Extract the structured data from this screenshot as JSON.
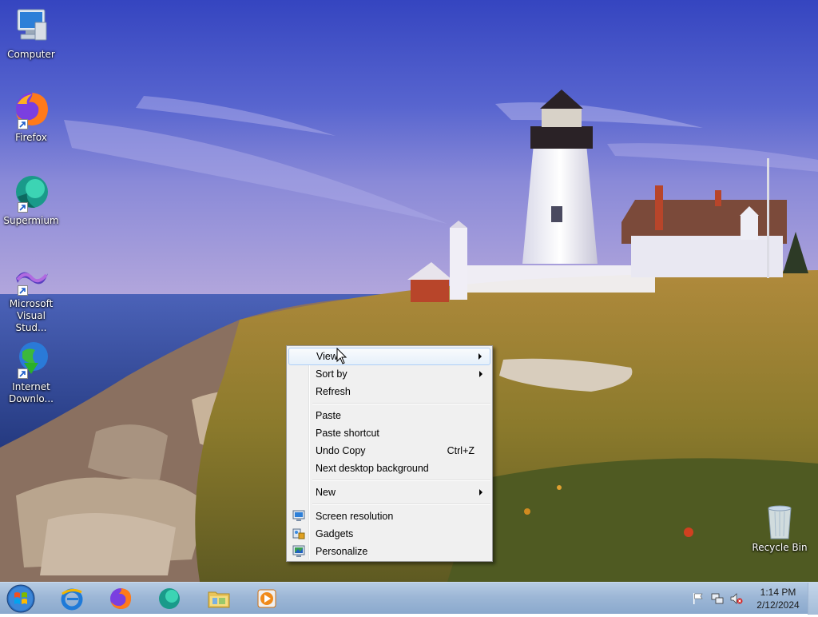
{
  "desktop": {
    "icons": [
      {
        "label": "Computer",
        "icon": "computer-icon"
      },
      {
        "label": "Firefox",
        "icon": "firefox-icon"
      },
      {
        "label": "Supermium",
        "icon": "supermium-icon"
      },
      {
        "label_line1": "Microsoft",
        "label_line2": "Visual Stud...",
        "icon": "visual-studio-icon"
      },
      {
        "label_line1": "Internet",
        "label_line2": "Downlo...",
        "icon": "internet-download-manager-icon"
      }
    ],
    "recycle_bin": {
      "label": "Recycle Bin",
      "icon": "recycle-bin-icon"
    }
  },
  "context_menu": {
    "items": [
      {
        "label": "View",
        "submenu": true,
        "highlighted": true
      },
      {
        "label": "Sort by",
        "submenu": true
      },
      {
        "label": "Refresh"
      },
      {
        "label": "Paste"
      },
      {
        "label": "Paste shortcut"
      },
      {
        "label": "Undo Copy",
        "shortcut": "Ctrl+Z"
      },
      {
        "label": "Next desktop background"
      },
      {
        "label": "New",
        "submenu": true
      },
      {
        "label": "Screen resolution",
        "icon": "screen-resolution-icon"
      },
      {
        "label": "Gadgets",
        "icon": "gadgets-icon"
      },
      {
        "label": "Personalize",
        "icon": "personalize-icon"
      }
    ]
  },
  "taskbar": {
    "buttons": [
      {
        "icon": "start-orb-icon"
      },
      {
        "icon": "internet-explorer-icon"
      },
      {
        "icon": "firefox-icon"
      },
      {
        "icon": "supermium-icon"
      },
      {
        "icon": "file-explorer-icon"
      },
      {
        "icon": "media-player-icon"
      }
    ],
    "tray": {
      "icons": [
        "action-center-flag-icon",
        "network-icon",
        "volume-muted-icon"
      ],
      "time": "1:14 PM",
      "date": "2/12/2024"
    }
  },
  "colors": {
    "sky_top": "#3b4fc4",
    "sea": "#2e4c9a",
    "taskbar": "#9db7d6",
    "menu_bg": "#f0f0f0",
    "menu_highlight_border": "#aecff7"
  }
}
